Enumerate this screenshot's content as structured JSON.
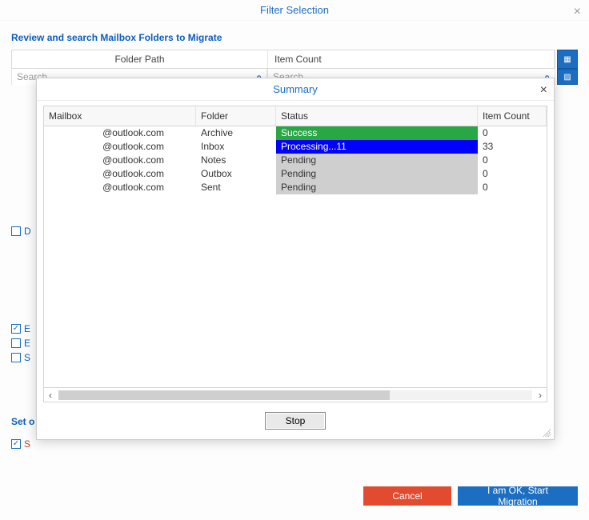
{
  "outer": {
    "title": "Filter Selection",
    "section_label": "Review and search Mailbox Folders to Migrate",
    "col_folder_path": "Folder Path",
    "col_item_count": "Item Count",
    "search_placeholder_left": "Search",
    "search_placeholder_right": "Search"
  },
  "left_checks": {
    "d_label": "D",
    "e1_label": "E",
    "e2_label": "E",
    "s_label": "S"
  },
  "set_section": {
    "label": "Set o",
    "s_label": "S"
  },
  "footer": {
    "cancel": "Cancel",
    "start": "I am OK, Start Migration"
  },
  "dialog": {
    "title": "Summary",
    "cols": {
      "mailbox": "Mailbox",
      "folder": "Folder",
      "status": "Status",
      "count": "Item Count"
    },
    "rows": [
      {
        "mailbox": "@outlook.com",
        "folder": "Archive",
        "status": "Success",
        "status_class": "status-success",
        "count": "0"
      },
      {
        "mailbox": "@outlook.com",
        "folder": "Inbox",
        "status": "Processing...11",
        "status_class": "status-processing",
        "count": "33"
      },
      {
        "mailbox": "@outlook.com",
        "folder": "Notes",
        "status": "Pending",
        "status_class": "status-pending",
        "count": "0"
      },
      {
        "mailbox": "@outlook.com",
        "folder": "Outbox",
        "status": "Pending",
        "status_class": "status-pending",
        "count": "0"
      },
      {
        "mailbox": "@outlook.com",
        "folder": "Sent",
        "status": "Pending",
        "status_class": "status-pending",
        "count": "0"
      }
    ],
    "stop": "Stop"
  }
}
